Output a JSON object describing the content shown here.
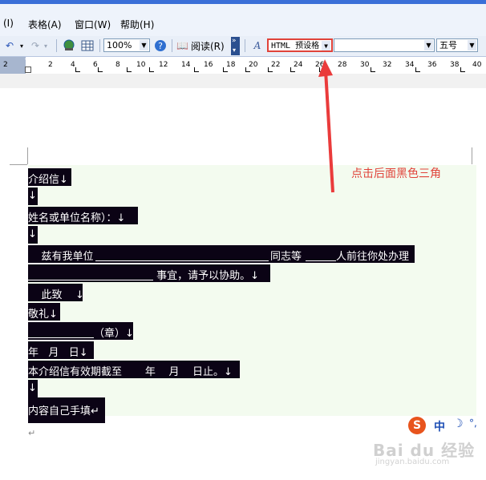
{
  "menu": {
    "partial_item": "(I)",
    "table": "表格(A)",
    "window": "窗口(W)",
    "help": "帮助(H)"
  },
  "toolbar": {
    "zoom": "100%",
    "read_label": "阅读(R)",
    "style_value": "HTML 预设格",
    "font_value": "",
    "size_value": "五号"
  },
  "ruler": {
    "numbers": [
      "2",
      "2",
      "4",
      "6",
      "8",
      "10",
      "12",
      "14",
      "16",
      "18",
      "20",
      "22",
      "24",
      "26",
      "28",
      "30",
      "32",
      "34",
      "36",
      "38",
      "40"
    ]
  },
  "annotation": "点击后面黑色三角",
  "document": {
    "lines": [
      {
        "text": "介绍信↓"
      },
      {
        "text": "↓"
      },
      {
        "text": "姓名或单位名称）：↓"
      },
      {
        "text": "↓"
      },
      {
        "text": "    兹有我单位"
      },
      {
        "text": " 事宜，请予以协助。↓"
      },
      {
        "text": "    此致    ↓"
      },
      {
        "text": "敬礼↓"
      },
      {
        "text": "（章）↓"
      },
      {
        "text": "年   月   日↓"
      },
      {
        "text": "本介绍信有效期截至       年    月    日止。↓"
      },
      {
        "text": "↓"
      },
      {
        "text": "内容自己手填↵"
      }
    ],
    "line5_mid": "同志等",
    "line5_end": "人前往你处办理",
    "end_mark": "↵"
  },
  "ime": {
    "brand": "S",
    "lang": "中",
    "moon": "☽",
    "punct": "°,"
  },
  "watermark": {
    "main": "Bai du 经验",
    "url": "jingyan.baidu.com"
  },
  "colors": {
    "highlight": "#0b0315",
    "page_bg": "#f3fbef",
    "annotation": "#e0433a",
    "arrow": "#ea3b3b"
  }
}
